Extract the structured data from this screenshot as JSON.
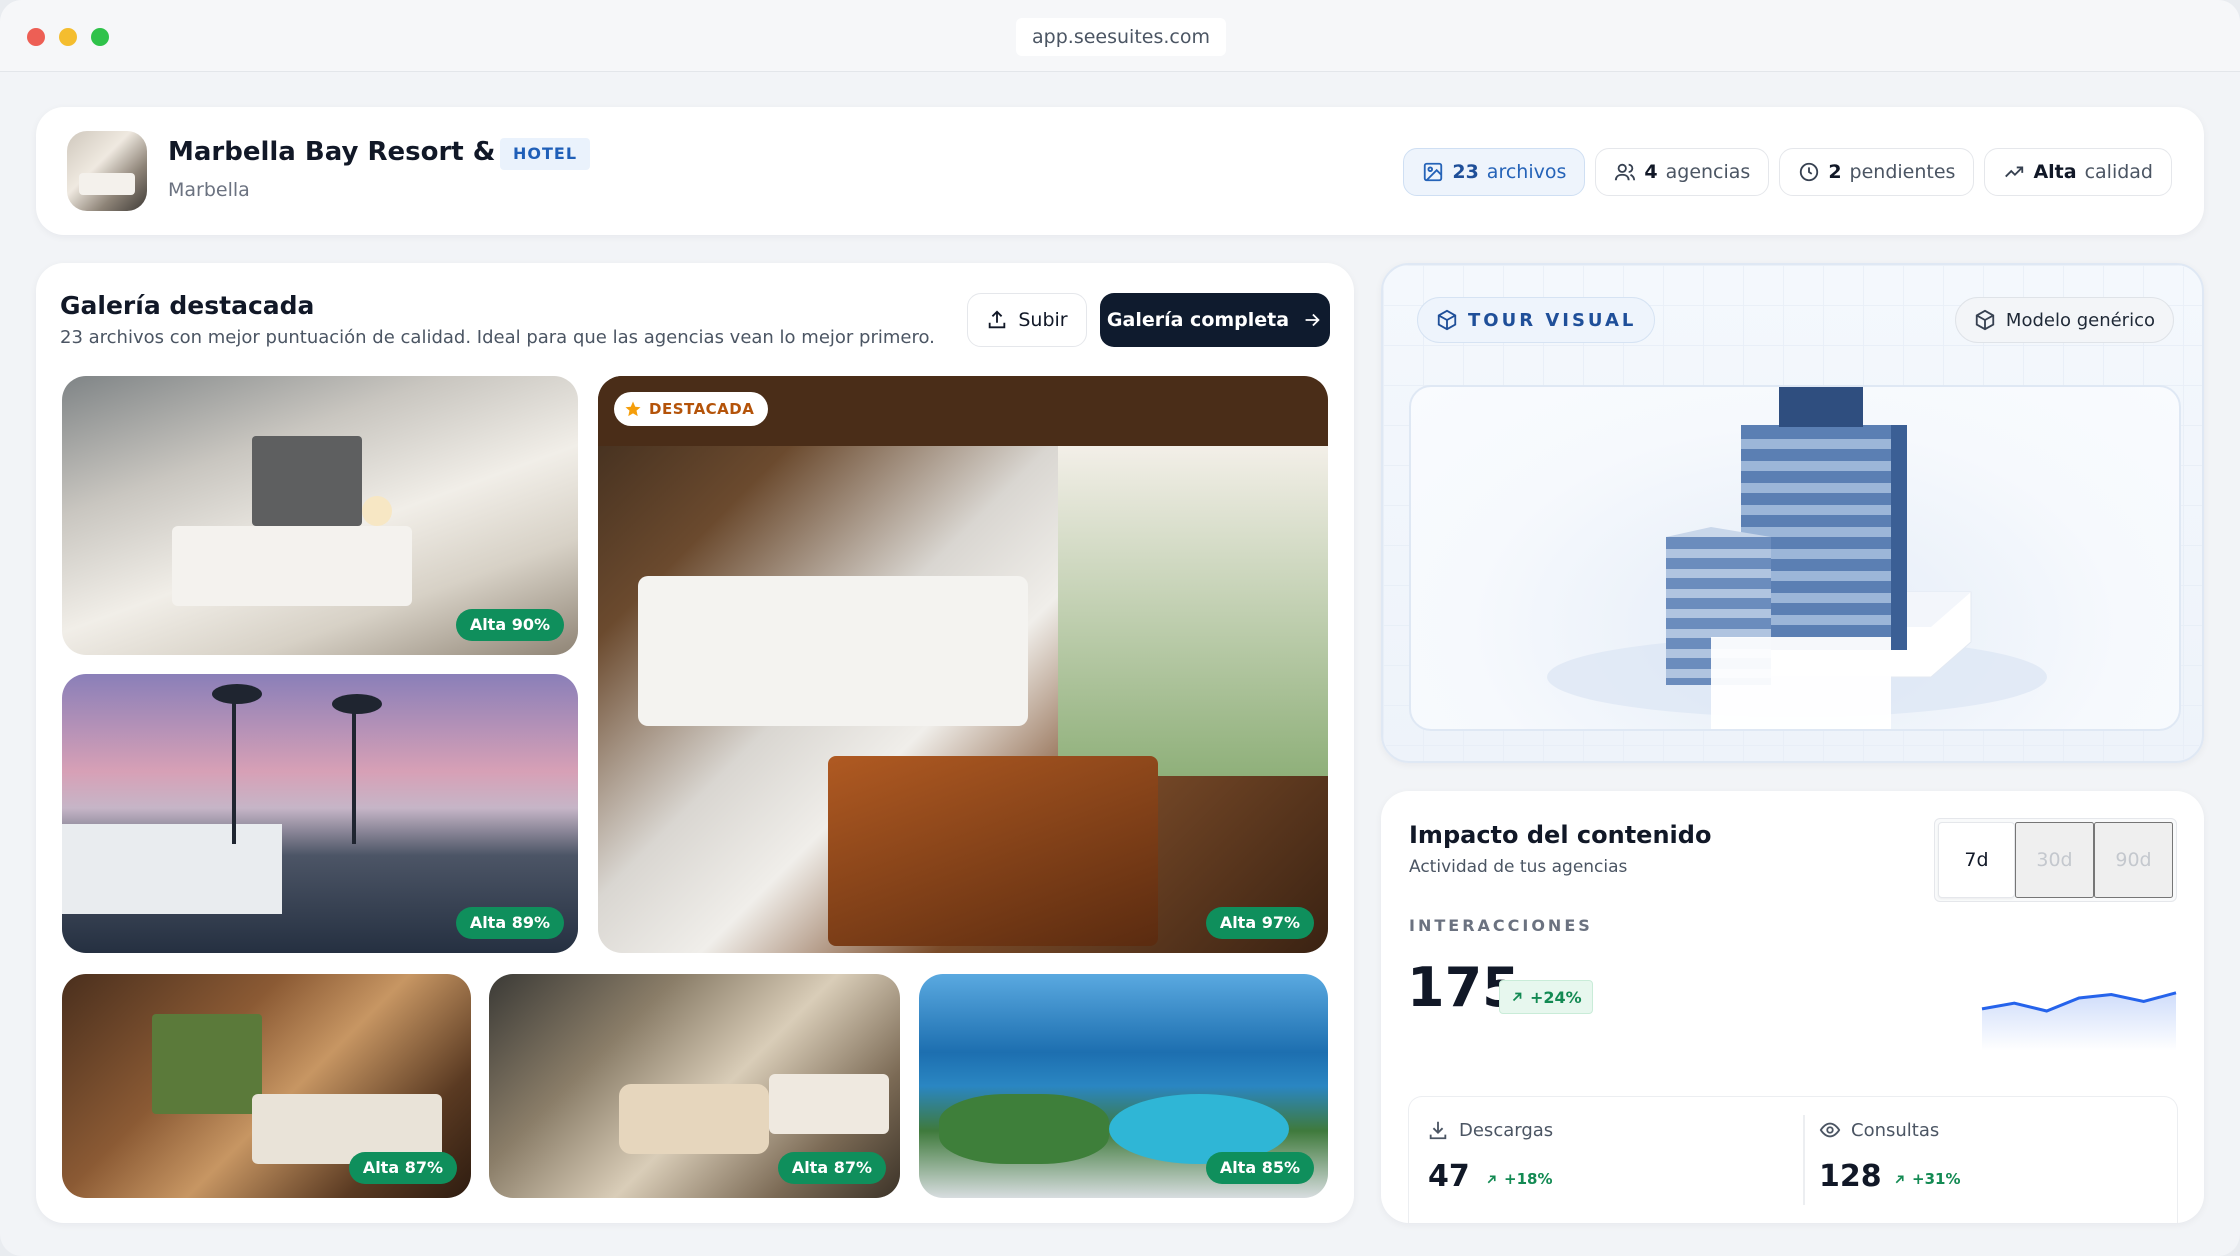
{
  "browser": {
    "url": "app.seesuites.com"
  },
  "header": {
    "hotel_name": "Marbella Bay Resort & Spa",
    "hotel_tag": "HOTEL",
    "city": "Marbella",
    "pills": [
      {
        "num": "23",
        "label": "archivos",
        "icon": "image-icon"
      },
      {
        "num": "4",
        "label": "agencias",
        "icon": "users-icon"
      },
      {
        "num": "2",
        "label": "pendientes",
        "icon": "clock-icon"
      },
      {
        "num": "Alta",
        "label": "calidad",
        "icon": "trending-up-icon"
      }
    ]
  },
  "gallery": {
    "title": "Galería destacada",
    "subtitle": "23 archivos con mejor puntuación de calidad. Ideal para que las agencias vean lo mejor primero.",
    "upload_label": "Subir",
    "full_label": "Galería completa",
    "featured_label": "DESTACADA",
    "photos": [
      {
        "badge": "Alta 90%"
      },
      {
        "badge": "Alta 89%"
      },
      {
        "badge": "Alta 97%"
      },
      {
        "badge": "Alta 87%"
      },
      {
        "badge": "Alta 87%"
      },
      {
        "badge": "Alta 85%"
      }
    ]
  },
  "tour": {
    "tag": "TOUR VISUAL",
    "model_label": "Modelo genérico"
  },
  "impact": {
    "title": "Impacto del contenido",
    "subtitle": "Actividad de tus agencias",
    "ranges": [
      "7d",
      "30d",
      "90d"
    ],
    "active_range": "7d",
    "kpi_label": "INTERACCIONES",
    "kpi_value": "175",
    "kpi_delta": "+24%",
    "sparkline": [
      0.55,
      0.42,
      0.6,
      0.3,
      0.22,
      0.38,
      0.18
    ],
    "descargas": {
      "label": "Descargas",
      "value": "47",
      "delta": "+18%"
    },
    "consultas": {
      "label": "Consultas",
      "value": "128",
      "delta": "+31%"
    }
  },
  "colors": {
    "accent": "#1f4f99",
    "dark_button": "#0f1b2e",
    "success": "#0f8f5c",
    "featured_star": "#f59e0b"
  }
}
